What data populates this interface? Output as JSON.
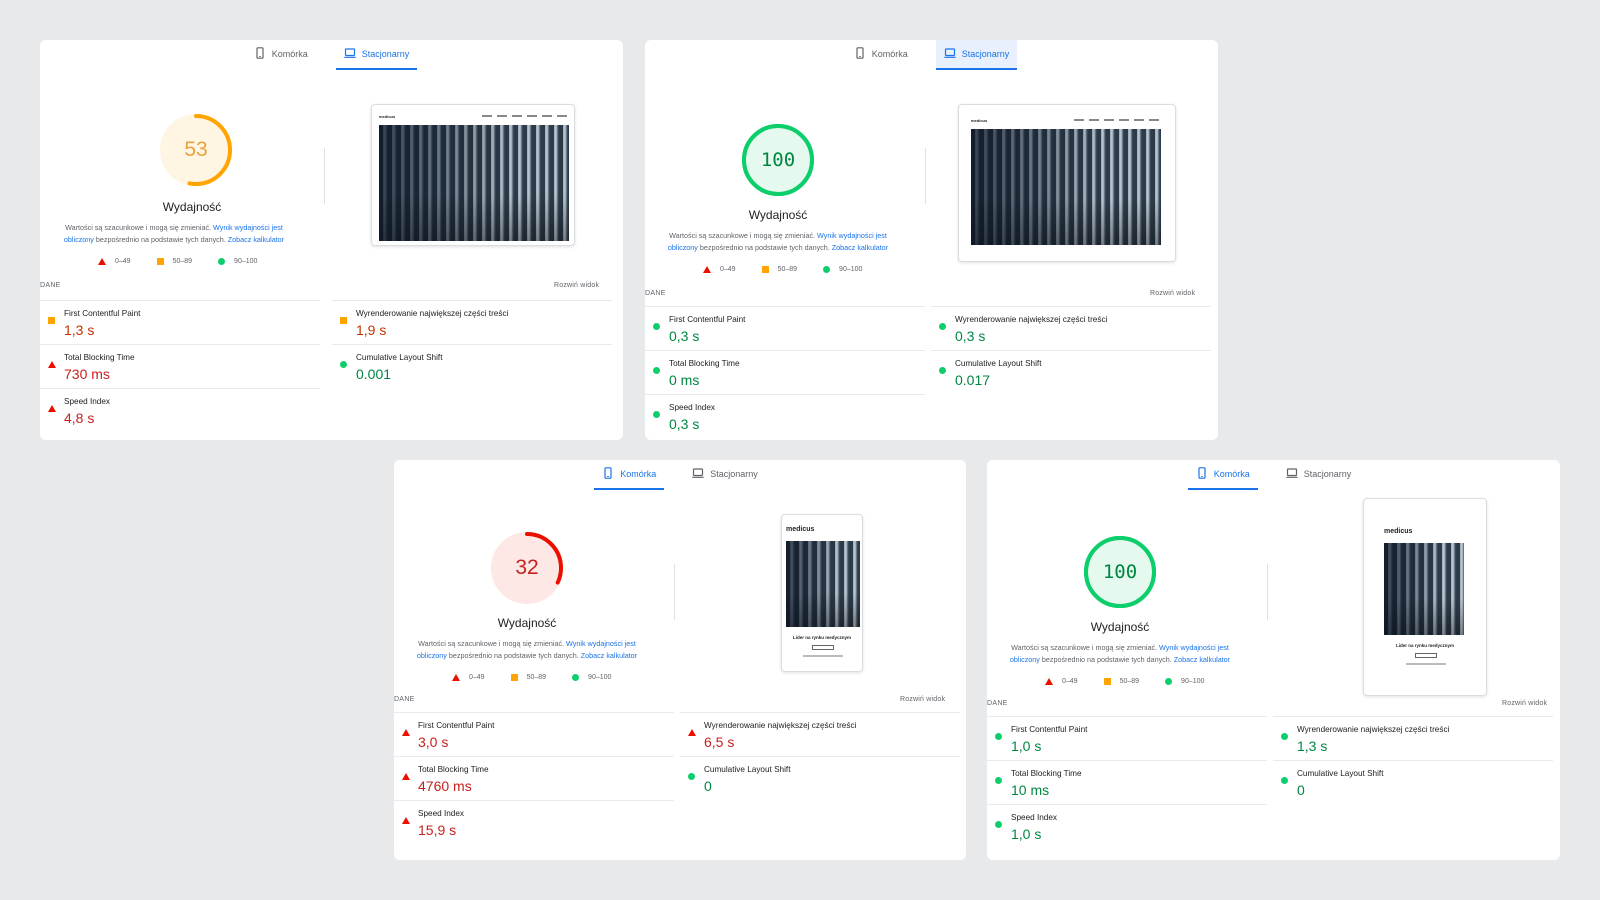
{
  "labels": {
    "tab_mobile": "Komórka",
    "tab_desktop": "Stacjonarny",
    "perf_title": "Wydajność",
    "desc_text_1": "Wartości są szacunkowe i mogą się zmieniać.",
    "desc_link_1": "Wynik wydajności jest obliczony",
    "desc_text_2": "bezpośrednio na podstawie tych danych.",
    "desc_link_2": "Zobacz kalkulator",
    "legend_fail": "0–49",
    "legend_average": "50–89",
    "legend_pass": "90–100",
    "data_heading": "DANE",
    "expand_view": "Rozwiń widok",
    "fcp": "First Contentful Paint",
    "tbt": "Total Blocking Time",
    "si": "Speed Index",
    "lcp": "Wyrenderowanie największej części treści",
    "cls": "Cumulative Layout Shift",
    "site_logo": "medicus",
    "site_caption": "Lider na rynku medycznym"
  },
  "colors": {
    "fail": "#eb0f00",
    "average": "#ffa400",
    "pass": "#0cce6b",
    "tab_active": "#1a73e8"
  },
  "reports": [
    {
      "device": "desktop",
      "score": "53",
      "score_value": 53,
      "rating": "average",
      "metrics": {
        "fcp": {
          "value": "1,3 s",
          "rating": "average"
        },
        "tbt": {
          "value": "730 ms",
          "rating": "fail"
        },
        "si": {
          "value": "4,8 s",
          "rating": "fail"
        },
        "lcp": {
          "value": "1,9 s",
          "rating": "average"
        },
        "cls": {
          "value": "0.001",
          "rating": "pass"
        }
      }
    },
    {
      "device": "desktop",
      "score": "100",
      "score_value": 100,
      "rating": "pass",
      "metrics": {
        "fcp": {
          "value": "0,3 s",
          "rating": "pass"
        },
        "tbt": {
          "value": "0 ms",
          "rating": "pass"
        },
        "si": {
          "value": "0,3 s",
          "rating": "pass"
        },
        "lcp": {
          "value": "0,3 s",
          "rating": "pass"
        },
        "cls": {
          "value": "0.017",
          "rating": "pass"
        }
      }
    },
    {
      "device": "mobile",
      "score": "32",
      "score_value": 32,
      "rating": "fail",
      "metrics": {
        "fcp": {
          "value": "3,0 s",
          "rating": "fail"
        },
        "tbt": {
          "value": "4760 ms",
          "rating": "fail"
        },
        "si": {
          "value": "15,9 s",
          "rating": "fail"
        },
        "lcp": {
          "value": "6,5 s",
          "rating": "fail"
        },
        "cls": {
          "value": "0",
          "rating": "pass"
        }
      }
    },
    {
      "device": "mobile",
      "score": "100",
      "score_value": 100,
      "rating": "pass",
      "metrics": {
        "fcp": {
          "value": "1,0 s",
          "rating": "pass"
        },
        "tbt": {
          "value": "10 ms",
          "rating": "pass"
        },
        "si": {
          "value": "1,0 s",
          "rating": "pass"
        },
        "lcp": {
          "value": "1,3 s",
          "rating": "pass"
        },
        "cls": {
          "value": "0",
          "rating": "pass"
        }
      }
    }
  ]
}
